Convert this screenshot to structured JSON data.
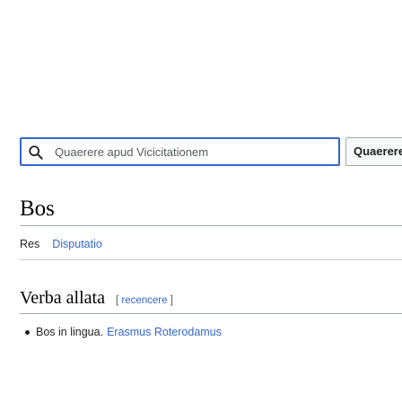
{
  "search": {
    "placeholder": "Quaerere apud Vicicitationem",
    "value": "",
    "button_label": "Quaerere"
  },
  "page": {
    "title": "Bos"
  },
  "tabs": [
    {
      "label": "Res"
    },
    {
      "label": "Disputatio"
    }
  ],
  "sections": [
    {
      "title": "Verba allata",
      "edit_open": "[",
      "edit_label": "recencere",
      "edit_close": "]",
      "items": [
        {
          "text": "Bos in lingua.",
          "link": "Erasmus Roterodamus"
        }
      ]
    }
  ],
  "colors": {
    "accent": "#3366cc",
    "text": "#202122",
    "border": "#a2a9b1"
  }
}
